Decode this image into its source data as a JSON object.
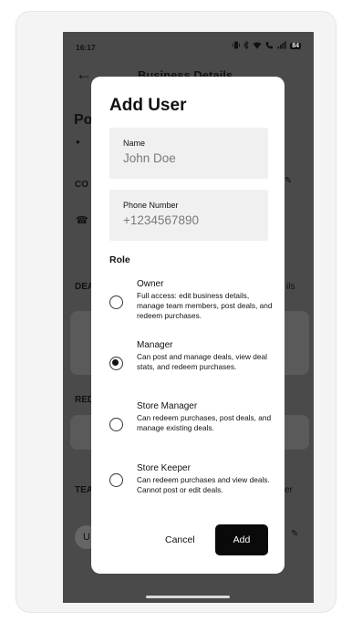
{
  "status_bar": {
    "time": "16:17",
    "icons": [
      "vibrate-icon",
      "bluetooth-icon",
      "wifi-icon",
      "call-icon",
      "signal-icon"
    ],
    "battery": "84"
  },
  "background": {
    "header_title": "Business Details",
    "business_name_partial": "Po",
    "contact_partial": "CO",
    "deals_partial": "DEA",
    "deals_right_partial": "ils",
    "redeem_partial": "RED",
    "team_partial": "TEA",
    "team_right_partial": "er",
    "avatar_initial": "U"
  },
  "modal": {
    "title": "Add User",
    "name_field": {
      "label": "Name",
      "placeholder": "John Doe"
    },
    "phone_field": {
      "label": "Phone Number",
      "placeholder": "+1234567890"
    },
    "role_title": "Role",
    "roles": [
      {
        "name": "Owner",
        "description": "Full access: edit business details, manage team members, post deals, and redeem purchases.",
        "selected": false
      },
      {
        "name": "Manager",
        "description": "Can post and manage deals, view deal stats, and redeem purchases.",
        "selected": true
      },
      {
        "name": "Store Manager",
        "description": "Can redeem purchases, post deals, and manage existing deals.",
        "selected": false
      },
      {
        "name": "Store Keeper",
        "description": "Can redeem purchases and view deals. Cannot post or edit deals.",
        "selected": false
      }
    ],
    "cancel_label": "Cancel",
    "add_label": "Add"
  },
  "colors": {
    "overlay": "#4a4a4a",
    "primary_button": "#0a0a0a",
    "field_background": "#f0f0f0"
  }
}
